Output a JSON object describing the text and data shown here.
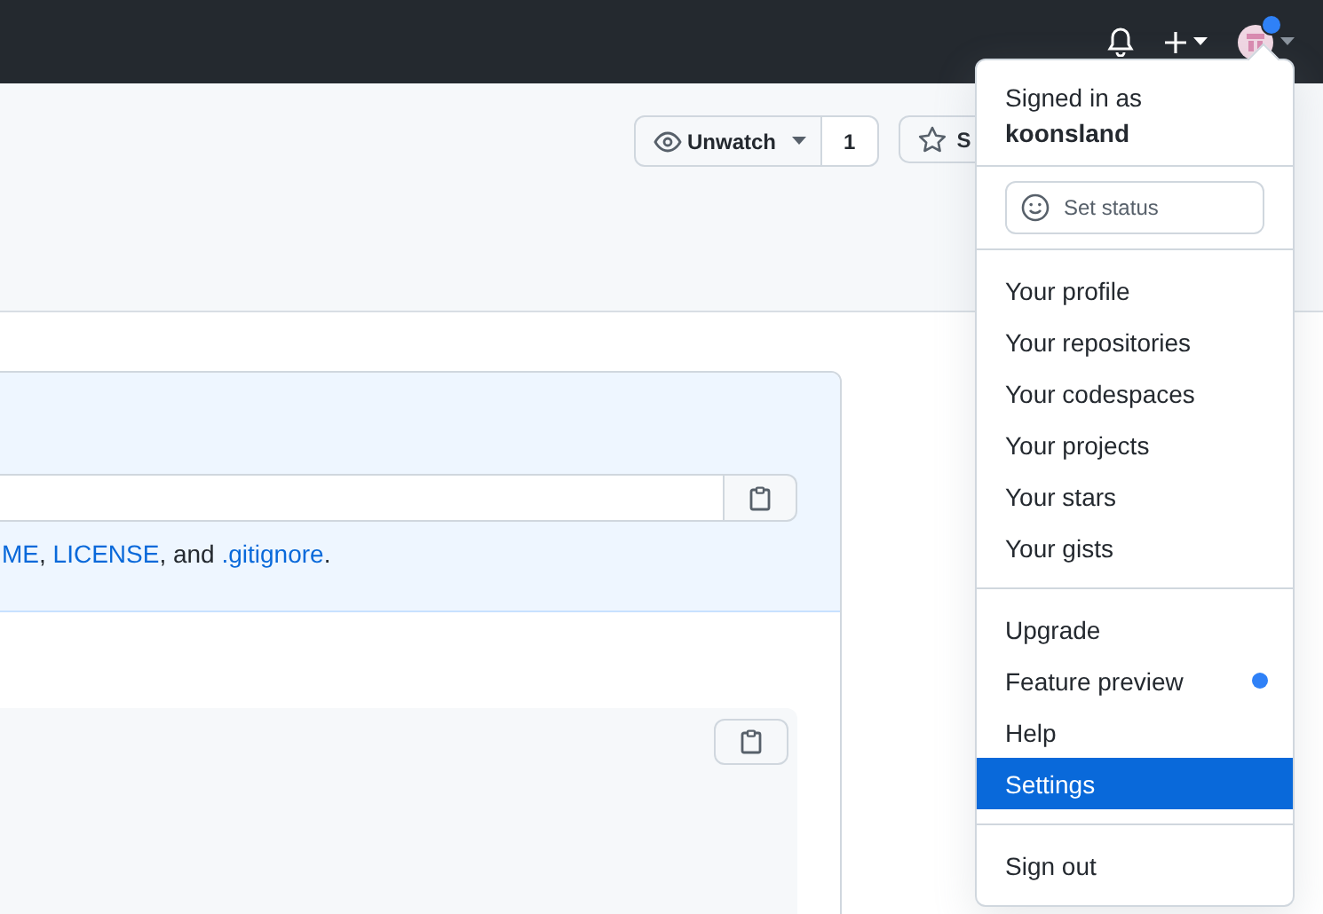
{
  "header": {
    "avatar_notification": true
  },
  "repo_actions": {
    "watch": {
      "label": "Unwatch",
      "count": "1"
    },
    "star": {
      "label": "S"
    }
  },
  "quick_setup": {
    "hint": [
      {
        "link": "ME",
        "after": ", "
      },
      {
        "link": "LICENSE",
        "after": ", and "
      },
      {
        "link": ".gitignore",
        "after": "."
      }
    ]
  },
  "user_menu": {
    "signed_in_label": "Signed in as",
    "username": "koonsland",
    "status_button": "Set status",
    "sections": [
      [
        {
          "label": "Your profile",
          "selected": false,
          "dot": false
        },
        {
          "label": "Your repositories",
          "selected": false,
          "dot": false
        },
        {
          "label": "Your codespaces",
          "selected": false,
          "dot": false
        },
        {
          "label": "Your projects",
          "selected": false,
          "dot": false
        },
        {
          "label": "Your stars",
          "selected": false,
          "dot": false
        },
        {
          "label": "Your gists",
          "selected": false,
          "dot": false
        }
      ],
      [
        {
          "label": "Upgrade",
          "selected": false,
          "dot": false
        },
        {
          "label": "Feature preview",
          "selected": false,
          "dot": true
        },
        {
          "label": "Help",
          "selected": false,
          "dot": false
        },
        {
          "label": "Settings",
          "selected": true,
          "dot": false
        }
      ],
      [
        {
          "label": "Sign out",
          "selected": false,
          "dot": false
        }
      ]
    ]
  }
}
